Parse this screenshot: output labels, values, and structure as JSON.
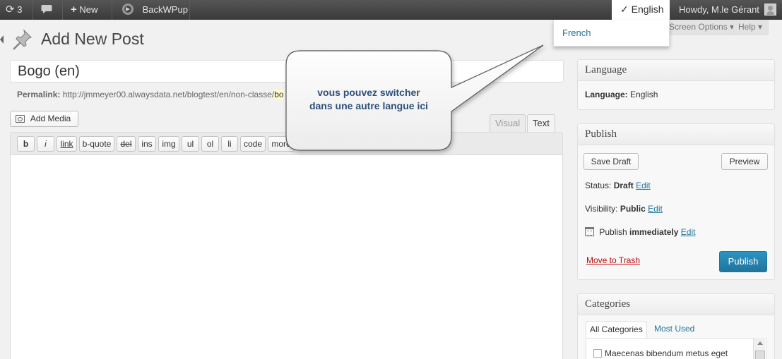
{
  "adminbar": {
    "updates_count": "3",
    "new_label": "New",
    "backwpup_label": "BackWPup",
    "language_check": "✓",
    "language_current": "English",
    "howdy": "Howdy, M.le Gérant"
  },
  "lang_dropdown": {
    "option": "French"
  },
  "screen": {
    "screen_options": "Screen Options ▾",
    "help": "Help ▾"
  },
  "page": {
    "title": "Add New Post",
    "post_title_value": "Bogo (en)",
    "permalink_label": "Permalink:",
    "permalink_url": "http://jmmeyer00.alwaysdata.net/blogtest/en/non-classe/",
    "permalink_slug": "bo"
  },
  "editor": {
    "add_media": "Add Media",
    "tab_visual": "Visual",
    "tab_text": "Text",
    "quicktags": [
      "b",
      "i",
      "link",
      "b-quote",
      "del",
      "ins",
      "img",
      "ul",
      "ol",
      "li",
      "code",
      "more"
    ]
  },
  "callout": {
    "line1": "vous pouvez switcher",
    "line2": "dans une autre langue ici"
  },
  "language_box": {
    "heading": "Language",
    "label": "Language:",
    "value": "English"
  },
  "publish_box": {
    "heading": "Publish",
    "save_draft": "Save Draft",
    "preview": "Preview",
    "status_label": "Status:",
    "status_value": "Draft",
    "visibility_label": "Visibility:",
    "visibility_value": "Public",
    "publish_label": "Publish",
    "publish_value": "immediately",
    "edit": "Edit",
    "move_to_trash": "Move to Trash",
    "publish_button": "Publish"
  },
  "categories_box": {
    "heading": "Categories",
    "tab_all": "All Categories",
    "tab_most_used": "Most Used",
    "items": [
      "Maecenas bibendum metus eget"
    ]
  },
  "colors": {
    "accent": "#21759b",
    "adminbar": "#464646",
    "trash": "#bc0b0b"
  }
}
